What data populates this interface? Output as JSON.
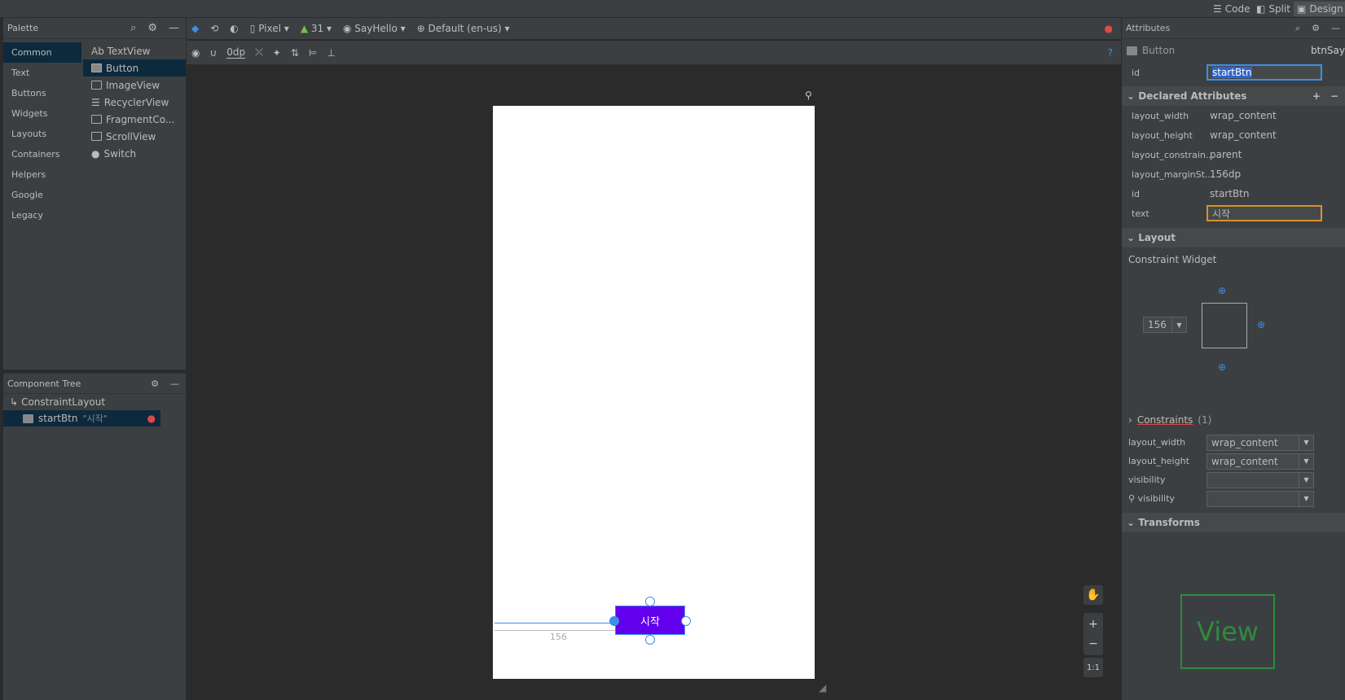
{
  "topbar": {
    "modes": [
      {
        "label": "Code"
      },
      {
        "label": "Split"
      },
      {
        "label": "Design"
      }
    ]
  },
  "palette": {
    "title": "Palette",
    "categories": [
      "Common",
      "Text",
      "Buttons",
      "Widgets",
      "Layouts",
      "Containers",
      "Helpers",
      "Google",
      "Legacy"
    ],
    "items": [
      {
        "label": "Ab TextView",
        "icon": "text-icon"
      },
      {
        "label": "Button",
        "icon": "button-icon"
      },
      {
        "label": "ImageView",
        "icon": "image-icon"
      },
      {
        "label": "RecyclerView",
        "icon": "list-icon"
      },
      {
        "label": "FragmentCo...",
        "icon": "fragment-icon"
      },
      {
        "label": "ScrollView",
        "icon": "scroll-icon"
      },
      {
        "label": "Switch",
        "icon": "switch-icon"
      }
    ]
  },
  "tree": {
    "title": "Component Tree",
    "root": "ConstraintLayout",
    "child": "startBtn",
    "child_text": "\"시작\""
  },
  "toolbar": {
    "device": "Pixel",
    "api": "31",
    "theme": "SayHello",
    "locale": "Default (en-us)",
    "margin": "0dp"
  },
  "canvas": {
    "button_text": "시작",
    "margin_label": "156"
  },
  "attributes": {
    "title": "Attributes",
    "widget_type": "Button",
    "widget_name": "btnSay",
    "id_label": "id",
    "id_value": "startBtn",
    "declared_title": "Declared Attributes",
    "declared": [
      {
        "k": "layout_width",
        "v": "wrap_content"
      },
      {
        "k": "layout_height",
        "v": "wrap_content"
      },
      {
        "k": "layout_constrain...",
        "v": "parent"
      },
      {
        "k": "layout_marginSt...",
        "v": "156dp"
      },
      {
        "k": "id",
        "v": "startBtn"
      },
      {
        "k": "text",
        "v": "시작"
      }
    ],
    "layout_title": "Layout",
    "constraint_widget": "Constraint Widget",
    "margin_value": "156",
    "constraints_title": "Constraints",
    "constraints_count": "(1)",
    "layout_rows": [
      {
        "k": "layout_width",
        "v": "wrap_content"
      },
      {
        "k": "layout_height",
        "v": "wrap_content"
      },
      {
        "k": "visibility",
        "v": ""
      },
      {
        "k": "visibility",
        "v": ""
      }
    ],
    "transforms_title": "Transforms",
    "view_label": "View"
  },
  "zoom": {
    "fit": "1:1"
  }
}
